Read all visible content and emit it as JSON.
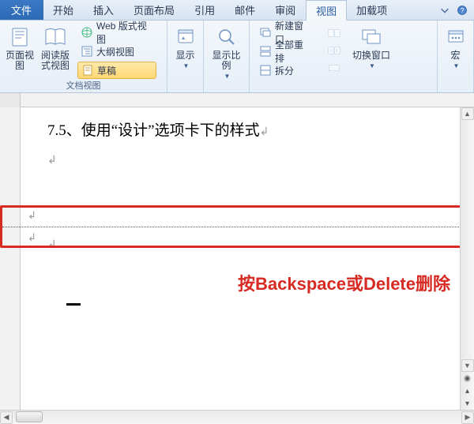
{
  "tabs": {
    "file": "文件",
    "home": "开始",
    "insert": "插入",
    "layout": "页面布局",
    "references": "引用",
    "mailings": "邮件",
    "review": "审阅",
    "view": "视图",
    "addins": "加载项",
    "active": "view"
  },
  "ribbon": {
    "views_group_title": "文档视图",
    "page_view": "页面视图",
    "reading_view": "阅读版式视图",
    "web_layout": "Web 版式视图",
    "outline": "大纲视图",
    "draft": "草稿",
    "show_group_btn": "显示",
    "zoom_group_btn": "显示比例",
    "window": {
      "new_window": "新建窗口",
      "arrange_all": "全部重排",
      "split": "拆分",
      "switch_windows": "切换窗口"
    },
    "macros": "宏"
  },
  "document": {
    "heading": "7.5、使用“设计”选项卡下的样式",
    "paragraph_mark": "↲",
    "annotation": "按Backspace或Delete删除"
  },
  "colors": {
    "accent_red": "#d62a22",
    "ribbon_blue": "#2d6ab6"
  }
}
